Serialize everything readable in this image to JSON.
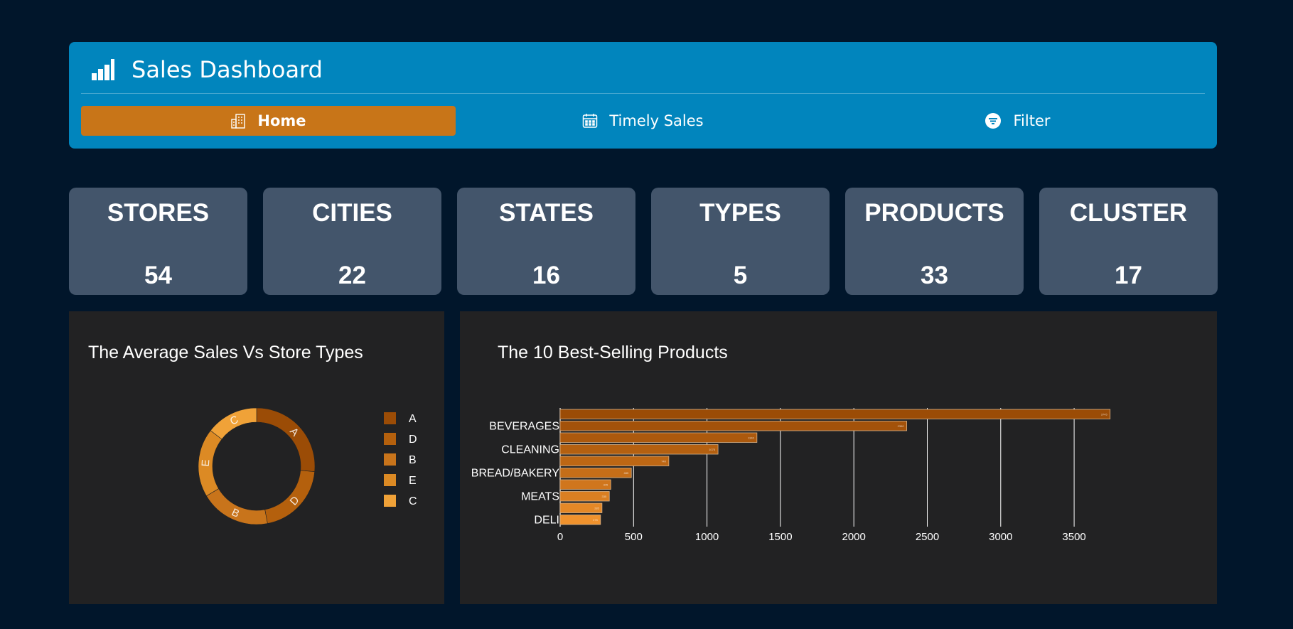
{
  "header": {
    "title": "Sales Dashboard",
    "icon": "bar-chart-icon",
    "nav": [
      {
        "label": "Home",
        "icon": "building-icon",
        "active": true
      },
      {
        "label": "Timely Sales",
        "icon": "calendar-icon",
        "active": false
      },
      {
        "label": "Filter",
        "icon": "filter-icon",
        "active": false
      }
    ]
  },
  "stats": [
    {
      "label": "STORES",
      "value": "54"
    },
    {
      "label": "CITIES",
      "value": "22"
    },
    {
      "label": "STATES",
      "value": "16"
    },
    {
      "label": "TYPES",
      "value": "5"
    },
    {
      "label": "PRODUCTS",
      "value": "33"
    },
    {
      "label": "CLUSTER",
      "value": "17"
    }
  ],
  "colors": {
    "background": "#01162b",
    "navbar": "#0185bd",
    "active_tab": "#c87518",
    "card": "#43556b",
    "panel": "#222223"
  },
  "chart_data": [
    {
      "type": "pie",
      "title": "The Average Sales Vs Store Types",
      "categories": [
        "A",
        "D",
        "B",
        "E",
        "C"
      ],
      "values": [
        26.5,
        20.5,
        19.5,
        19,
        14.5
      ],
      "colors": [
        "#9b4c06",
        "#b4600d",
        "#c8741b",
        "#dc8a24",
        "#f0a238"
      ],
      "legend": "right",
      "hole": true
    },
    {
      "type": "bar",
      "orientation": "horizontal",
      "title": "The 10 Best-Selling Products",
      "categories": [
        "",
        "BEVERAGES",
        "",
        "CLEANING",
        "",
        "BREAD/BAKERY",
        "",
        "MEATS",
        "",
        "DELI"
      ],
      "values": [
        3745,
        2360,
        1340,
        1075,
        740,
        485,
        345,
        335,
        285,
        275
      ],
      "colors": [
        "#9b4c06",
        "#a3520a",
        "#ac590d",
        "#b46010",
        "#bd6714",
        "#c56e18",
        "#d0761d",
        "#da7f22",
        "#e48827",
        "#f0922d"
      ],
      "xlim": [
        0,
        3800
      ],
      "xticks": [
        0,
        500,
        1000,
        1500,
        2000,
        2500,
        3000,
        3500
      ],
      "grid": true
    }
  ]
}
